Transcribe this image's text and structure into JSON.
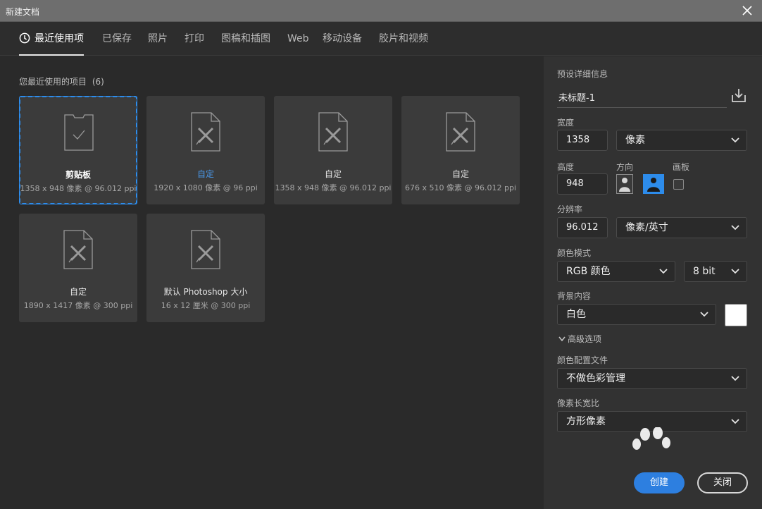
{
  "window": {
    "title": "新建文档"
  },
  "tabs": [
    {
      "label": "最近使用项",
      "active": true
    },
    {
      "label": "已保存"
    },
    {
      "label": "照片"
    },
    {
      "label": "打印"
    },
    {
      "label": "图稿和插图"
    },
    {
      "label": "Web"
    },
    {
      "label": "移动设备"
    },
    {
      "label": "胶片和视频"
    }
  ],
  "recent": {
    "heading": "您最近使用的项目",
    "count": "(6)",
    "items": [
      {
        "name": "剪贴板",
        "meta": "1358 x 948 像素 @ 96.012 ppi",
        "icon": "clipboard-icon",
        "selected": true
      },
      {
        "name": "自定",
        "meta": "1920 x 1080 像素 @ 96 ppi",
        "icon": "document-tools-icon"
      },
      {
        "name": "自定",
        "meta": "1358 x 948 像素 @ 96.012 ppi",
        "icon": "document-tools-icon"
      },
      {
        "name": "自定",
        "meta": "676 x 510 像素 @ 96.012 ppi",
        "icon": "document-tools-icon"
      },
      {
        "name": "自定",
        "meta": "1890 x 1417 像素 @ 300 ppi",
        "icon": "document-tools-icon"
      },
      {
        "name": "默认 Photoshop 大小",
        "meta": "16 x 12 厘米 @ 300 ppi",
        "icon": "document-tools-icon"
      }
    ]
  },
  "preset": {
    "heading": "预设详细信息",
    "doc_name": "未标题-1",
    "width_label": "宽度",
    "width_value": "1358",
    "width_unit": "像素",
    "height_label": "高度",
    "height_value": "948",
    "orientation_label": "方向",
    "orientation_selected": "landscape",
    "artboard_label": "画板",
    "artboard_checked": false,
    "resolution_label": "分辨率",
    "resolution_value": "96.012",
    "resolution_unit": "像素/英寸",
    "color_mode_label": "颜色模式",
    "color_mode": "RGB 颜色",
    "bit_depth": "8 bit",
    "background_label": "背景内容",
    "background": "白色",
    "background_color": "#ffffff",
    "advanced_label": "高级选项",
    "color_profile_label": "颜色配置文件",
    "color_profile": "不做色彩管理",
    "pixel_aspect_label": "像素长宽比",
    "pixel_aspect": "方形像素"
  },
  "buttons": {
    "create": "创建",
    "close": "关闭"
  },
  "colors": {
    "accent": "#2d8ceb",
    "create_button": "#2d7fe0",
    "selected_tab_text": "#ffffff"
  }
}
